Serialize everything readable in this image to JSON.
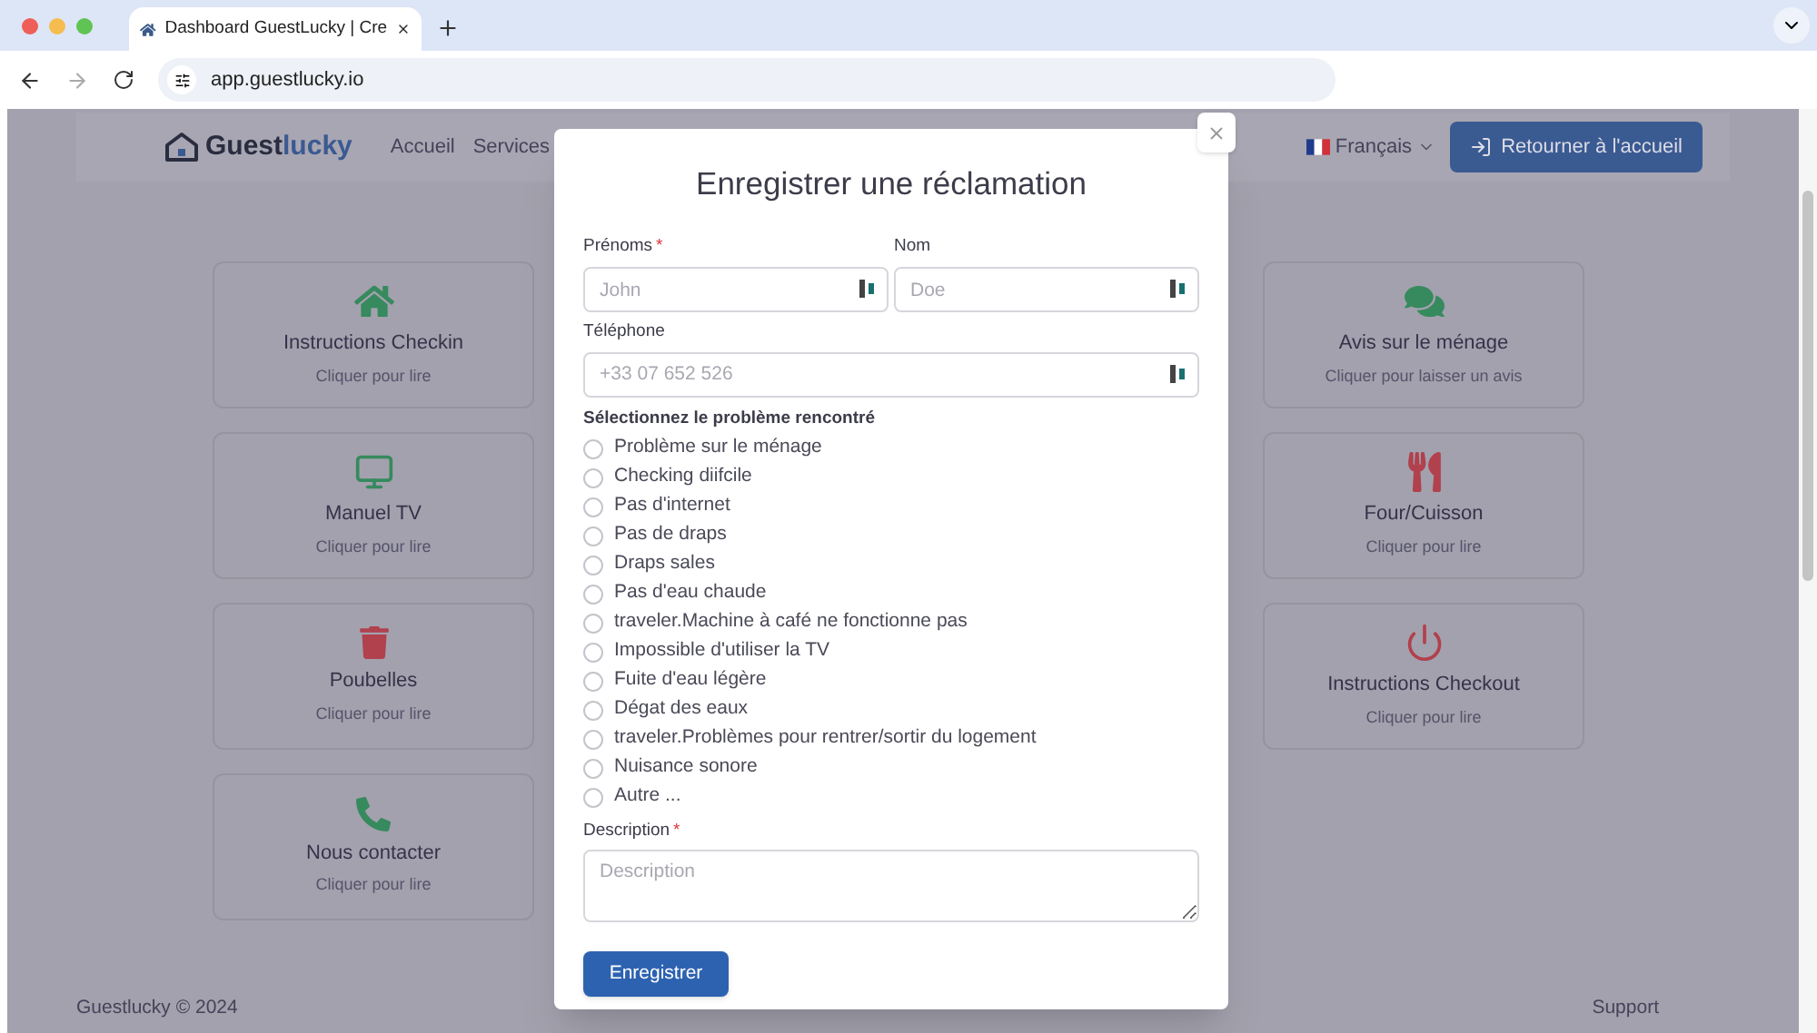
{
  "browser": {
    "tab_title": "Dashboard GuestLucky | Cre",
    "url": "app.guestlucky.io"
  },
  "header": {
    "logo": {
      "part_1": "Guest",
      "part_2": "lucky"
    },
    "nav": [
      "Accueil",
      "Services"
    ],
    "language": "Français",
    "home_button": "Retourner à l'accueil"
  },
  "cards_left": [
    {
      "kind": "home",
      "color": "#368a5e",
      "title": "Instructions Checkin",
      "subtitle": "Cliquer pour lire"
    },
    {
      "kind": "tv",
      "color": "#368a5e",
      "title": "Manuel TV",
      "subtitle": "Cliquer pour lire"
    },
    {
      "kind": "trash",
      "color": "#b0414d",
      "title": "Poubelles",
      "subtitle": "Cliquer pour lire"
    },
    {
      "kind": "phone",
      "color": "#368a5e",
      "title": "Nous contacter",
      "subtitle": "Cliquer pour lire"
    }
  ],
  "cards_right": [
    {
      "kind": "chat",
      "color": "#368a5e",
      "title": "Avis sur le ménage",
      "subtitle": "Cliquer pour laisser un avis"
    },
    {
      "kind": "utensils",
      "color": "#b0414d",
      "title": "Four/Cuisson",
      "subtitle": "Cliquer pour lire"
    },
    {
      "kind": "power",
      "color": "#b0414d",
      "title": "Instructions Checkout",
      "subtitle": "Cliquer pour lire"
    }
  ],
  "footer": {
    "copyright": "Guestlucky © 2024",
    "support": "Support"
  },
  "modal": {
    "title": "Enregistrer une réclamation",
    "name_fields": [
      {
        "label": "Prénoms",
        "required_mark": "*",
        "placeholder": "John"
      },
      {
        "label": "Nom",
        "placeholder": "Doe"
      }
    ],
    "phone": {
      "label": "Téléphone",
      "placeholder": "+33 07 652 526"
    },
    "question": "Sélectionnez le problème rencontré",
    "options": [
      {
        "label": "Problème sur le ménage",
        "selected": false
      },
      {
        "label": "Checking diifcile",
        "selected": false
      },
      {
        "label": "Pas d'internet",
        "selected": false
      },
      {
        "label": "Pas de draps",
        "selected": false
      },
      {
        "label": "Draps sales",
        "selected": false
      },
      {
        "label": "Pas d'eau chaude",
        "selected": false
      },
      {
        "label": "traveler.Machine à café ne fonctionne pas",
        "selected": false
      },
      {
        "label": "Impossible d'utiliser la TV",
        "selected": false
      },
      {
        "label": "Fuite d'eau légère",
        "selected": false
      },
      {
        "label": "Dégat des eaux",
        "selected": false
      },
      {
        "label": "traveler.Problèmes pour rentrer/sortir du logement",
        "selected": false
      },
      {
        "label": "Nuisance sonore",
        "selected": false
      },
      {
        "label": "Autre ...",
        "selected": false
      }
    ],
    "description": {
      "label": "Description",
      "required_mark": "*",
      "placeholder": "Description"
    },
    "submit": "Enregistrer"
  }
}
